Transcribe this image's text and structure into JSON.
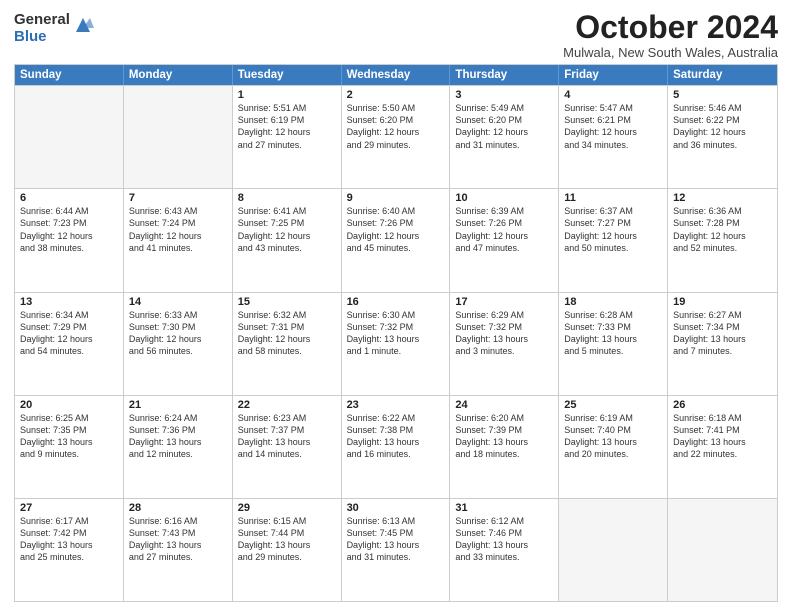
{
  "logo": {
    "general": "General",
    "blue": "Blue"
  },
  "title": "October 2024",
  "location": "Mulwala, New South Wales, Australia",
  "days": [
    "Sunday",
    "Monday",
    "Tuesday",
    "Wednesday",
    "Thursday",
    "Friday",
    "Saturday"
  ],
  "weeks": [
    [
      {
        "day": "",
        "lines": []
      },
      {
        "day": "",
        "lines": []
      },
      {
        "day": "1",
        "lines": [
          "Sunrise: 5:51 AM",
          "Sunset: 6:19 PM",
          "Daylight: 12 hours",
          "and 27 minutes."
        ]
      },
      {
        "day": "2",
        "lines": [
          "Sunrise: 5:50 AM",
          "Sunset: 6:20 PM",
          "Daylight: 12 hours",
          "and 29 minutes."
        ]
      },
      {
        "day": "3",
        "lines": [
          "Sunrise: 5:49 AM",
          "Sunset: 6:20 PM",
          "Daylight: 12 hours",
          "and 31 minutes."
        ]
      },
      {
        "day": "4",
        "lines": [
          "Sunrise: 5:47 AM",
          "Sunset: 6:21 PM",
          "Daylight: 12 hours",
          "and 34 minutes."
        ]
      },
      {
        "day": "5",
        "lines": [
          "Sunrise: 5:46 AM",
          "Sunset: 6:22 PM",
          "Daylight: 12 hours",
          "and 36 minutes."
        ]
      }
    ],
    [
      {
        "day": "6",
        "lines": [
          "Sunrise: 6:44 AM",
          "Sunset: 7:23 PM",
          "Daylight: 12 hours",
          "and 38 minutes."
        ]
      },
      {
        "day": "7",
        "lines": [
          "Sunrise: 6:43 AM",
          "Sunset: 7:24 PM",
          "Daylight: 12 hours",
          "and 41 minutes."
        ]
      },
      {
        "day": "8",
        "lines": [
          "Sunrise: 6:41 AM",
          "Sunset: 7:25 PM",
          "Daylight: 12 hours",
          "and 43 minutes."
        ]
      },
      {
        "day": "9",
        "lines": [
          "Sunrise: 6:40 AM",
          "Sunset: 7:26 PM",
          "Daylight: 12 hours",
          "and 45 minutes."
        ]
      },
      {
        "day": "10",
        "lines": [
          "Sunrise: 6:39 AM",
          "Sunset: 7:26 PM",
          "Daylight: 12 hours",
          "and 47 minutes."
        ]
      },
      {
        "day": "11",
        "lines": [
          "Sunrise: 6:37 AM",
          "Sunset: 7:27 PM",
          "Daylight: 12 hours",
          "and 50 minutes."
        ]
      },
      {
        "day": "12",
        "lines": [
          "Sunrise: 6:36 AM",
          "Sunset: 7:28 PM",
          "Daylight: 12 hours",
          "and 52 minutes."
        ]
      }
    ],
    [
      {
        "day": "13",
        "lines": [
          "Sunrise: 6:34 AM",
          "Sunset: 7:29 PM",
          "Daylight: 12 hours",
          "and 54 minutes."
        ]
      },
      {
        "day": "14",
        "lines": [
          "Sunrise: 6:33 AM",
          "Sunset: 7:30 PM",
          "Daylight: 12 hours",
          "and 56 minutes."
        ]
      },
      {
        "day": "15",
        "lines": [
          "Sunrise: 6:32 AM",
          "Sunset: 7:31 PM",
          "Daylight: 12 hours",
          "and 58 minutes."
        ]
      },
      {
        "day": "16",
        "lines": [
          "Sunrise: 6:30 AM",
          "Sunset: 7:32 PM",
          "Daylight: 13 hours",
          "and 1 minute."
        ]
      },
      {
        "day": "17",
        "lines": [
          "Sunrise: 6:29 AM",
          "Sunset: 7:32 PM",
          "Daylight: 13 hours",
          "and 3 minutes."
        ]
      },
      {
        "day": "18",
        "lines": [
          "Sunrise: 6:28 AM",
          "Sunset: 7:33 PM",
          "Daylight: 13 hours",
          "and 5 minutes."
        ]
      },
      {
        "day": "19",
        "lines": [
          "Sunrise: 6:27 AM",
          "Sunset: 7:34 PM",
          "Daylight: 13 hours",
          "and 7 minutes."
        ]
      }
    ],
    [
      {
        "day": "20",
        "lines": [
          "Sunrise: 6:25 AM",
          "Sunset: 7:35 PM",
          "Daylight: 13 hours",
          "and 9 minutes."
        ]
      },
      {
        "day": "21",
        "lines": [
          "Sunrise: 6:24 AM",
          "Sunset: 7:36 PM",
          "Daylight: 13 hours",
          "and 12 minutes."
        ]
      },
      {
        "day": "22",
        "lines": [
          "Sunrise: 6:23 AM",
          "Sunset: 7:37 PM",
          "Daylight: 13 hours",
          "and 14 minutes."
        ]
      },
      {
        "day": "23",
        "lines": [
          "Sunrise: 6:22 AM",
          "Sunset: 7:38 PM",
          "Daylight: 13 hours",
          "and 16 minutes."
        ]
      },
      {
        "day": "24",
        "lines": [
          "Sunrise: 6:20 AM",
          "Sunset: 7:39 PM",
          "Daylight: 13 hours",
          "and 18 minutes."
        ]
      },
      {
        "day": "25",
        "lines": [
          "Sunrise: 6:19 AM",
          "Sunset: 7:40 PM",
          "Daylight: 13 hours",
          "and 20 minutes."
        ]
      },
      {
        "day": "26",
        "lines": [
          "Sunrise: 6:18 AM",
          "Sunset: 7:41 PM",
          "Daylight: 13 hours",
          "and 22 minutes."
        ]
      }
    ],
    [
      {
        "day": "27",
        "lines": [
          "Sunrise: 6:17 AM",
          "Sunset: 7:42 PM",
          "Daylight: 13 hours",
          "and 25 minutes."
        ]
      },
      {
        "day": "28",
        "lines": [
          "Sunrise: 6:16 AM",
          "Sunset: 7:43 PM",
          "Daylight: 13 hours",
          "and 27 minutes."
        ]
      },
      {
        "day": "29",
        "lines": [
          "Sunrise: 6:15 AM",
          "Sunset: 7:44 PM",
          "Daylight: 13 hours",
          "and 29 minutes."
        ]
      },
      {
        "day": "30",
        "lines": [
          "Sunrise: 6:13 AM",
          "Sunset: 7:45 PM",
          "Daylight: 13 hours",
          "and 31 minutes."
        ]
      },
      {
        "day": "31",
        "lines": [
          "Sunrise: 6:12 AM",
          "Sunset: 7:46 PM",
          "Daylight: 13 hours",
          "and 33 minutes."
        ]
      },
      {
        "day": "",
        "lines": []
      },
      {
        "day": "",
        "lines": []
      }
    ]
  ]
}
